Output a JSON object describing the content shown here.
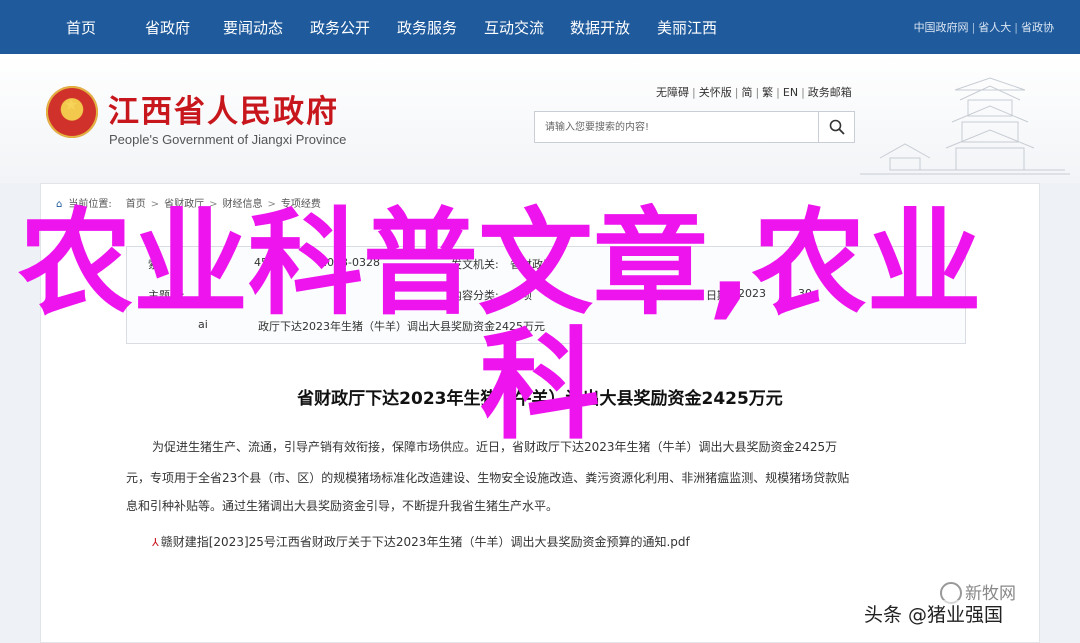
{
  "nav": {
    "items": [
      "首页",
      "省政府",
      "要闻动态",
      "政务公开",
      "政务服务",
      "互动交流",
      "数据开放",
      "美丽江西"
    ],
    "top_links": [
      "中国政府网",
      "省人大",
      "省政协"
    ]
  },
  "header": {
    "title": "江西省人民政府",
    "subtitle": "People's Government of Jiangxi Province",
    "access_links": [
      "无障碍",
      "关怀版",
      "简",
      "繁",
      "EN",
      "政务邮箱"
    ],
    "search": {
      "placeholder": "请输入您要搜索的内容!"
    }
  },
  "breadcrumb": {
    "label": "当前位置:",
    "items": [
      "首页",
      "省财政厅",
      "财经信息",
      "专项经费"
    ]
  },
  "meta": {
    "index_label": "索",
    "index_value": "45",
    "date_value": "2023-0328",
    "issuer_label": "发文机关:",
    "issuer_value": "省财政厅",
    "cat_label": "主题分:",
    "category_label": "内容分类:",
    "category_value": "专项",
    "pubdate_label": "日期:",
    "pubdate_value": "2023",
    "pubdate_value_end": "30",
    "title_snippet_left": "ai",
    "title_snippet_right": "政厅下达2023年生猪（牛羊）调出大县奖励资金2425万元"
  },
  "article": {
    "title": "省财政厅下达2023年生猪（牛羊）调出大县奖励资金2425万元",
    "lines": [
      "为促进生猪生产、流通，引导产销有效衔接，保障市场供应。近日，省财政厅下达2023年生猪（牛羊）调出大县奖励资金2425万",
      "元，专项用于全省23个县（市、区）的规模猪场标准化改造建设、生物安全设施改造、粪污资源化利用、非洲猪瘟监测、规模猪场贷款贴",
      "息和引种补贴等。通过生猪调出大县奖励资金引导，不断提升我省生猪生产水平。"
    ],
    "attachment": "赣财建指[2023]25号江西省财政厅关于下达2023年生猪（牛羊）调出大县奖励资金预算的通知.pdf"
  },
  "overlay": {
    "line1": "农业科普文章,农业",
    "line2": "科"
  },
  "watermarks": {
    "logo_text": "新牧网",
    "source": "头条 @猪业强国"
  }
}
